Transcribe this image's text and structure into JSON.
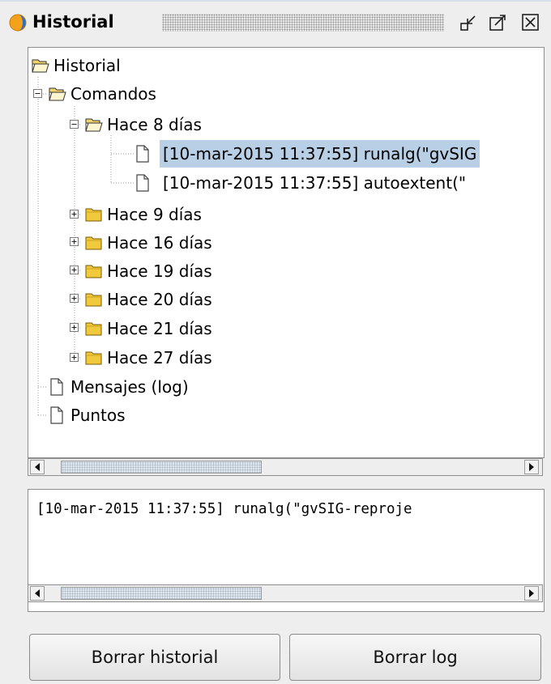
{
  "window": {
    "title": "Historial",
    "icons": [
      "gvsig-app-icon",
      "minimize-icon",
      "maximize-icon",
      "close-icon"
    ]
  },
  "tree": {
    "root": "Historial",
    "comandos": "Comandos",
    "days_8": "Hace 8 días",
    "entry_1": "[10-mar-2015 11:37:55] runalg(\"gvSIG",
    "entry_2": "[10-mar-2015 11:37:55] autoextent(\"",
    "days_9": "Hace 9 días",
    "days_16": "Hace 16 días",
    "days_19": "Hace 19 días",
    "days_20": "Hace 20 días",
    "days_21": "Hace 21 días",
    "days_27": "Hace 27 días",
    "mensajes": "Mensajes (log)",
    "puntos": "Puntos",
    "selected_item": "entry_1"
  },
  "log": {
    "text": "[10-mar-2015 11:37:55] runalg(\"gvSIG-reproje"
  },
  "buttons": {
    "clear_history": "Borrar historial",
    "clear_log": "Borrar log"
  },
  "colors": {
    "selection": "#b8cfe5",
    "folder_yellow": "#f0c93c",
    "window_bg": "#eeeeee"
  }
}
